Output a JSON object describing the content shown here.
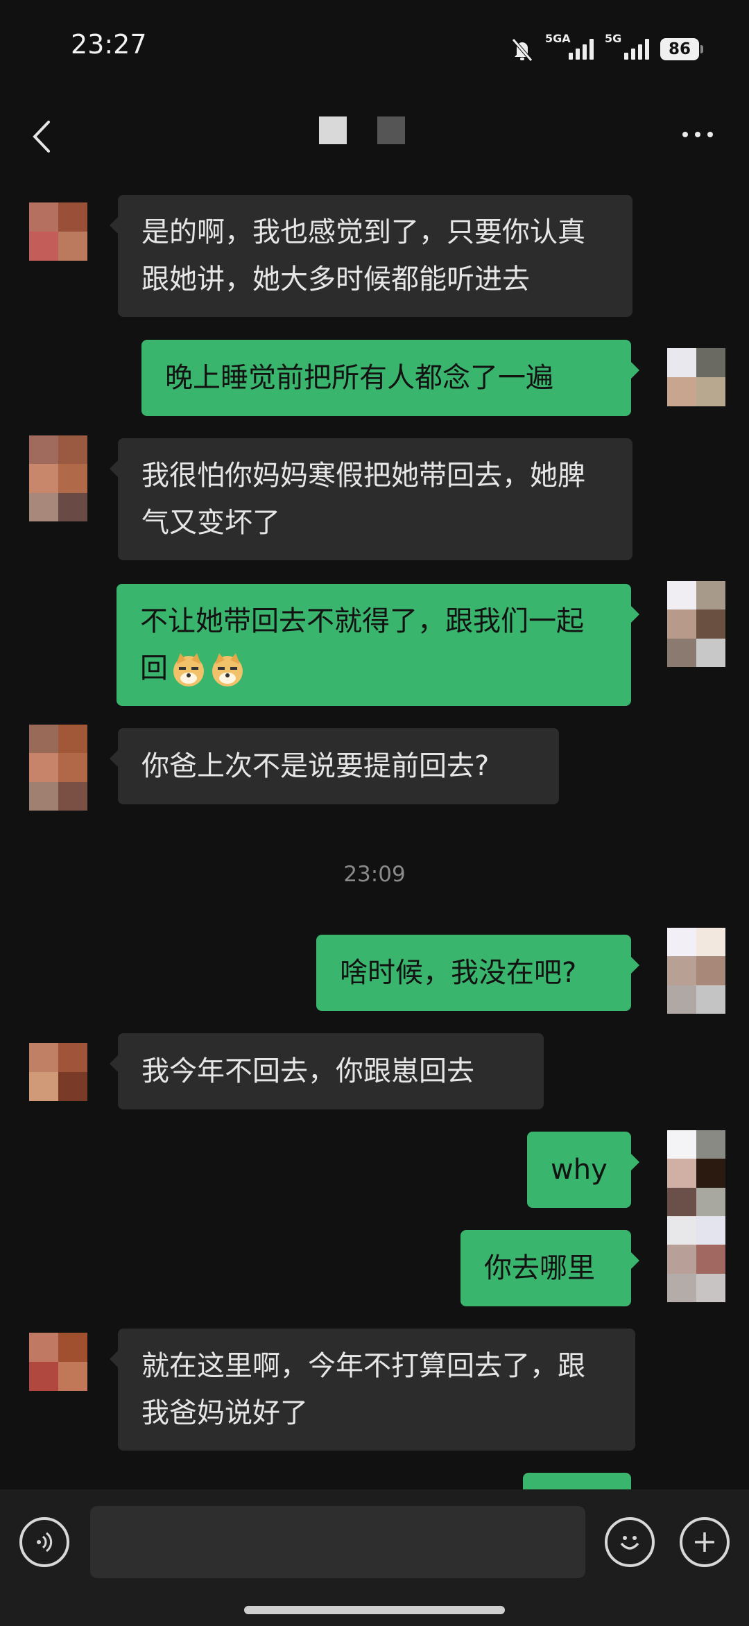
{
  "status_bar": {
    "time": "23:27",
    "network1": "5GA",
    "network2": "5G",
    "battery": "86",
    "icons": [
      "bell-muted-icon",
      "signal-icon",
      "signal-icon",
      "battery-icon"
    ]
  },
  "header": {
    "back_icon": "chevron-left-icon",
    "more_icon": "more-horizontal-icon"
  },
  "messages": [
    {
      "side": "in",
      "text": "是的啊，我也感觉到了，只要你认真跟她讲，她大多时候都能听进去"
    },
    {
      "side": "out",
      "text": "晚上睡觉前把所有人都念了一遍"
    },
    {
      "side": "in",
      "text": "我很怕你妈妈寒假把她带回去，她脾气又变坏了"
    },
    {
      "side": "out",
      "text": "不让她带回去不就得了，跟我们一起回",
      "emoji": "doge-emoji"
    },
    {
      "side": "in",
      "text": "你爸上次不是说要提前回去?"
    },
    {
      "side": "out",
      "text": "啥时候，我没在吧?"
    },
    {
      "side": "in",
      "text": "我今年不回去，你跟崽回去"
    },
    {
      "side": "out",
      "text": "why"
    },
    {
      "side": "out",
      "text": "你去哪里"
    },
    {
      "side": "in",
      "text": "就在这里啊，今年不打算回去了，跟我爸妈说好了"
    }
  ],
  "timestamp": "23:09",
  "input_bar": {
    "voice_icon": "voice-icon",
    "emoji_icon": "smiley-icon",
    "plus_icon": "plus-circle-icon"
  },
  "colors": {
    "background": "#111111",
    "incoming_bubble": "#2c2c2c",
    "outgoing_bubble": "#39b56d"
  }
}
